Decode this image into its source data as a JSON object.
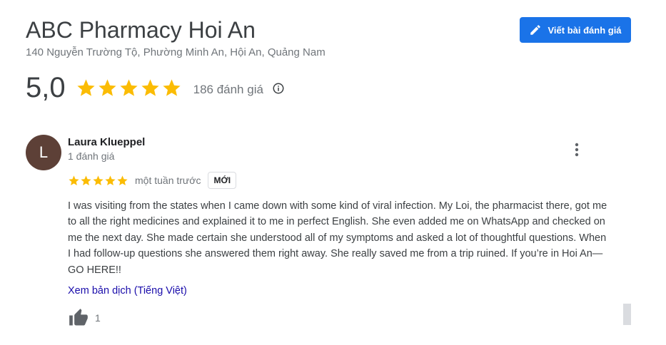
{
  "place": {
    "name": "ABC Pharmacy Hoi An",
    "address": "140 Nguyễn Trường Tộ, Phường Minh An, Hội An, Quảng Nam"
  },
  "header": {
    "write_review_label": "Viết bài đánh giá",
    "write_review_icon": "pencil-icon"
  },
  "summary": {
    "rating": "5,0",
    "stars": 5,
    "review_count_label": "186 đánh giá",
    "info_icon": "info-icon"
  },
  "review": {
    "avatar_letter": "L",
    "reviewer_name": "Laura Klueppel",
    "reviewer_meta": "1 đánh giá",
    "stars": 5,
    "time": "một tuần trước",
    "badge": "MỚI",
    "text": "I was visiting from the states when I came down with some kind of viral infection. My Loi, the pharmacist there, got me to all the right medicines and explained it to me in perfect English. She even added me on WhatsApp and checked on me the next day. She made certain she understood all of my symptoms and asked a lot of thoughtful questions. When I had follow-up questions she answered them right away. She really saved me from a trip ruined. If you’re in Hoi An—GO HERE!!",
    "translate_label": "Xem bản dịch (Tiếng Việt)",
    "like_count": "1"
  },
  "colors": {
    "accent": "#1a73e8",
    "star": "#fbbc04",
    "avatar": "#5d4037",
    "link": "#1a0dab"
  }
}
